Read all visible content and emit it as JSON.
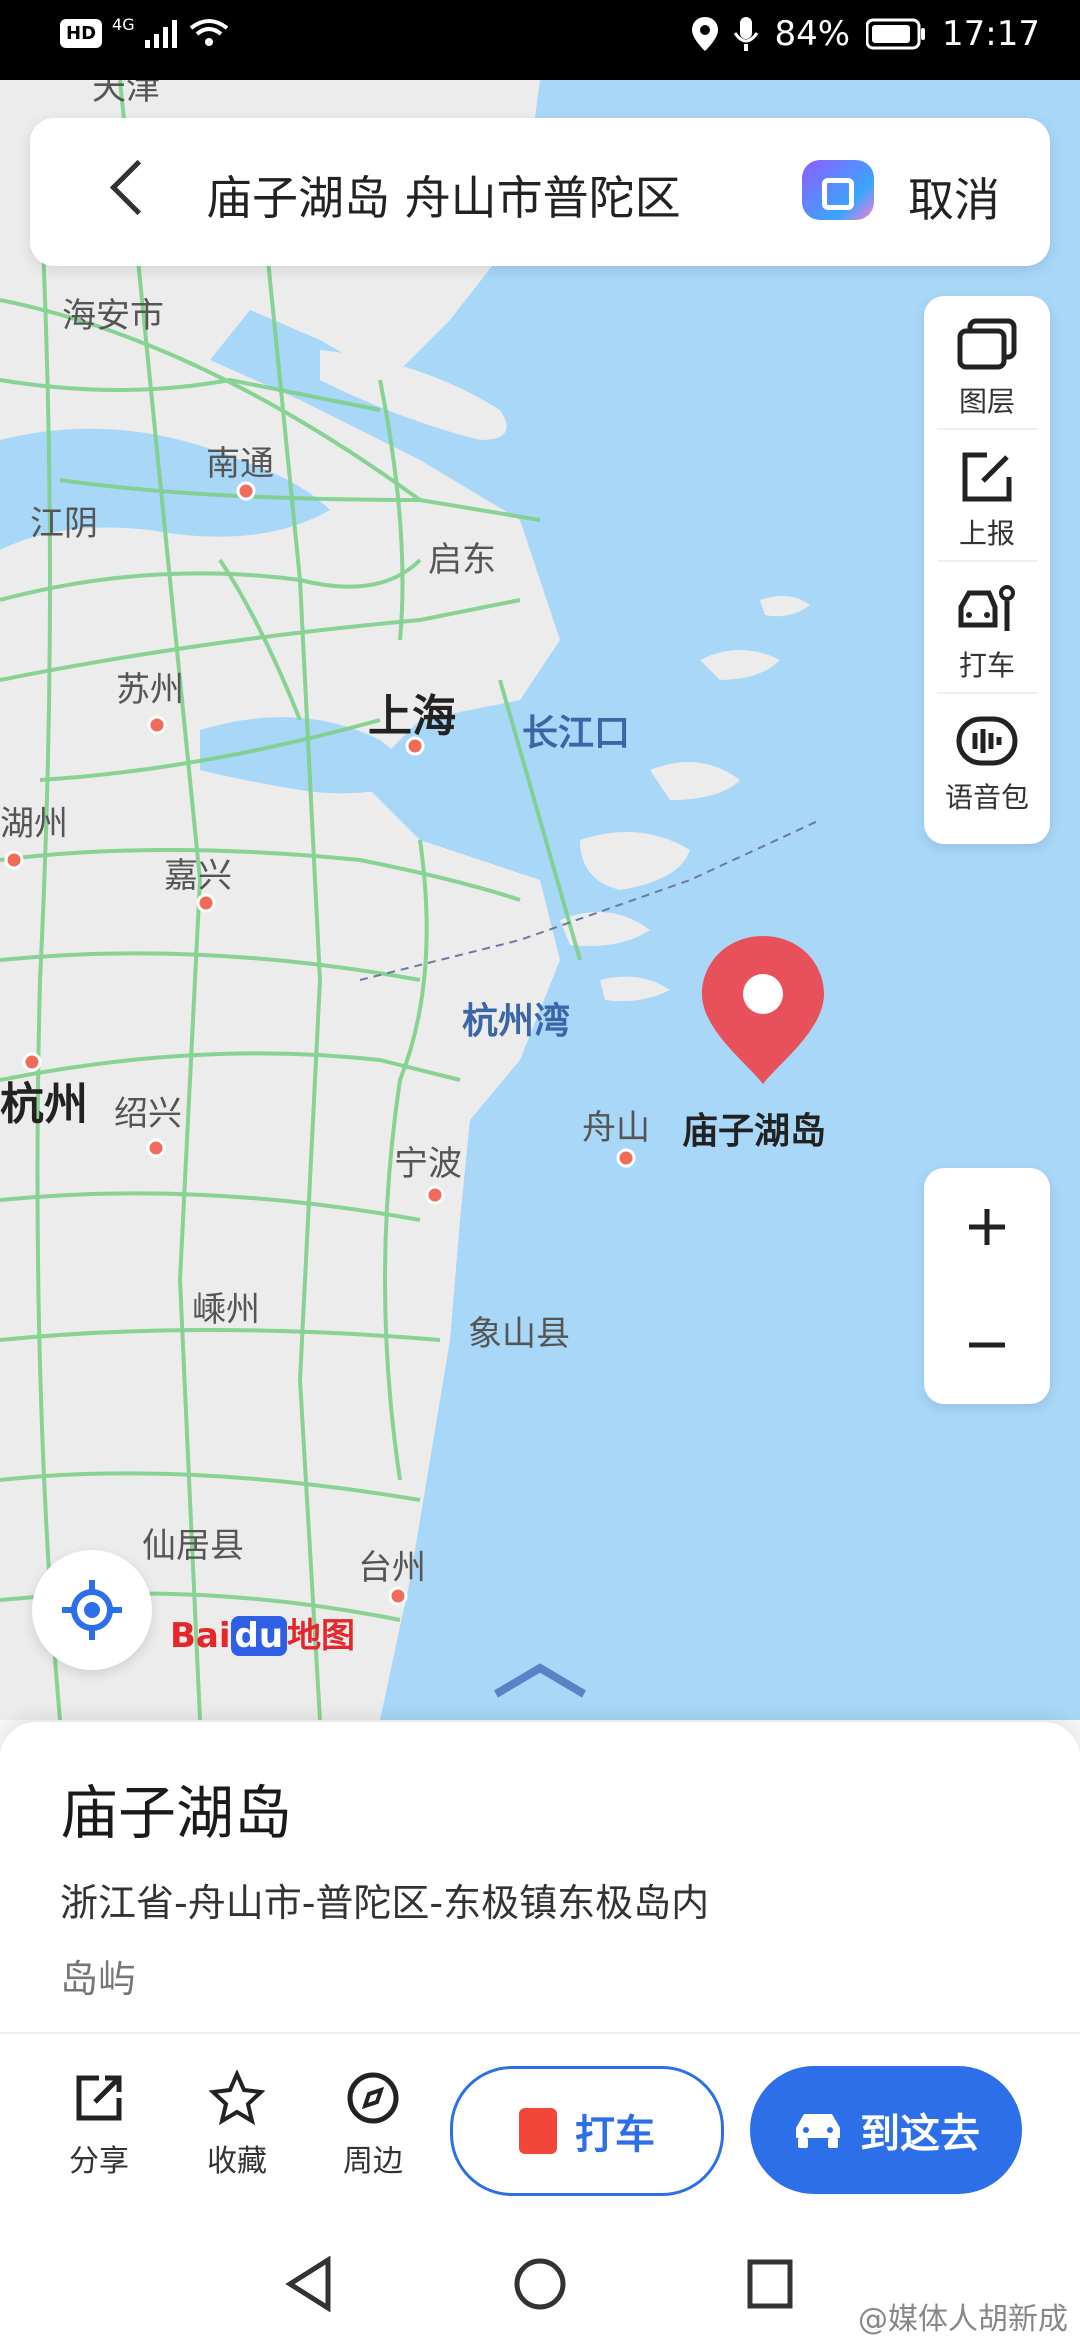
{
  "status_bar": {
    "hd": "HD",
    "network": "4G",
    "battery": "84%",
    "time": "17:17"
  },
  "search": {
    "query": "庙子湖岛 舟山市普陀区",
    "cancel_label": "取消"
  },
  "tools": {
    "layers": "图层",
    "report": "上报",
    "taxi": "打车",
    "voice": "语音包"
  },
  "map_labels": {
    "tianjin_partial": "天津",
    "haian": "海安市",
    "nantong": "南通",
    "jiangyin": "江阴",
    "qidong": "启东",
    "suzhou": "苏州",
    "shanghai": "上海",
    "changjiangkou": "长江口",
    "huzhou_partial": "湖州",
    "jiaxing": "嘉兴",
    "hangzhouwan": "杭州湾",
    "hangzhou_partial": "杭州",
    "shaoxing": "绍兴",
    "zhoushan": "舟山",
    "miaozihu": "庙子湖岛",
    "ningbo": "宁波",
    "shengzhou": "嵊州",
    "xiangshan": "象山县",
    "xianju": "仙居县",
    "taizhou": "台州"
  },
  "brand": {
    "bai": "Bai",
    "du": "du",
    "ditu": "地图"
  },
  "place": {
    "name": "庙子湖岛",
    "address": "浙江省-舟山市-普陀区-东极镇东极岛内",
    "category": "岛屿"
  },
  "actions": {
    "share": "分享",
    "favorite": "收藏",
    "nearby": "周边",
    "taxi": "打车",
    "go": "到这去"
  },
  "watermark": "@媒体人胡新成",
  "colors": {
    "accent": "#2d6fe8",
    "pin": "#e8505b",
    "sea": "#a8d7f8",
    "land": "#ececec",
    "road": "#7ed08a"
  }
}
